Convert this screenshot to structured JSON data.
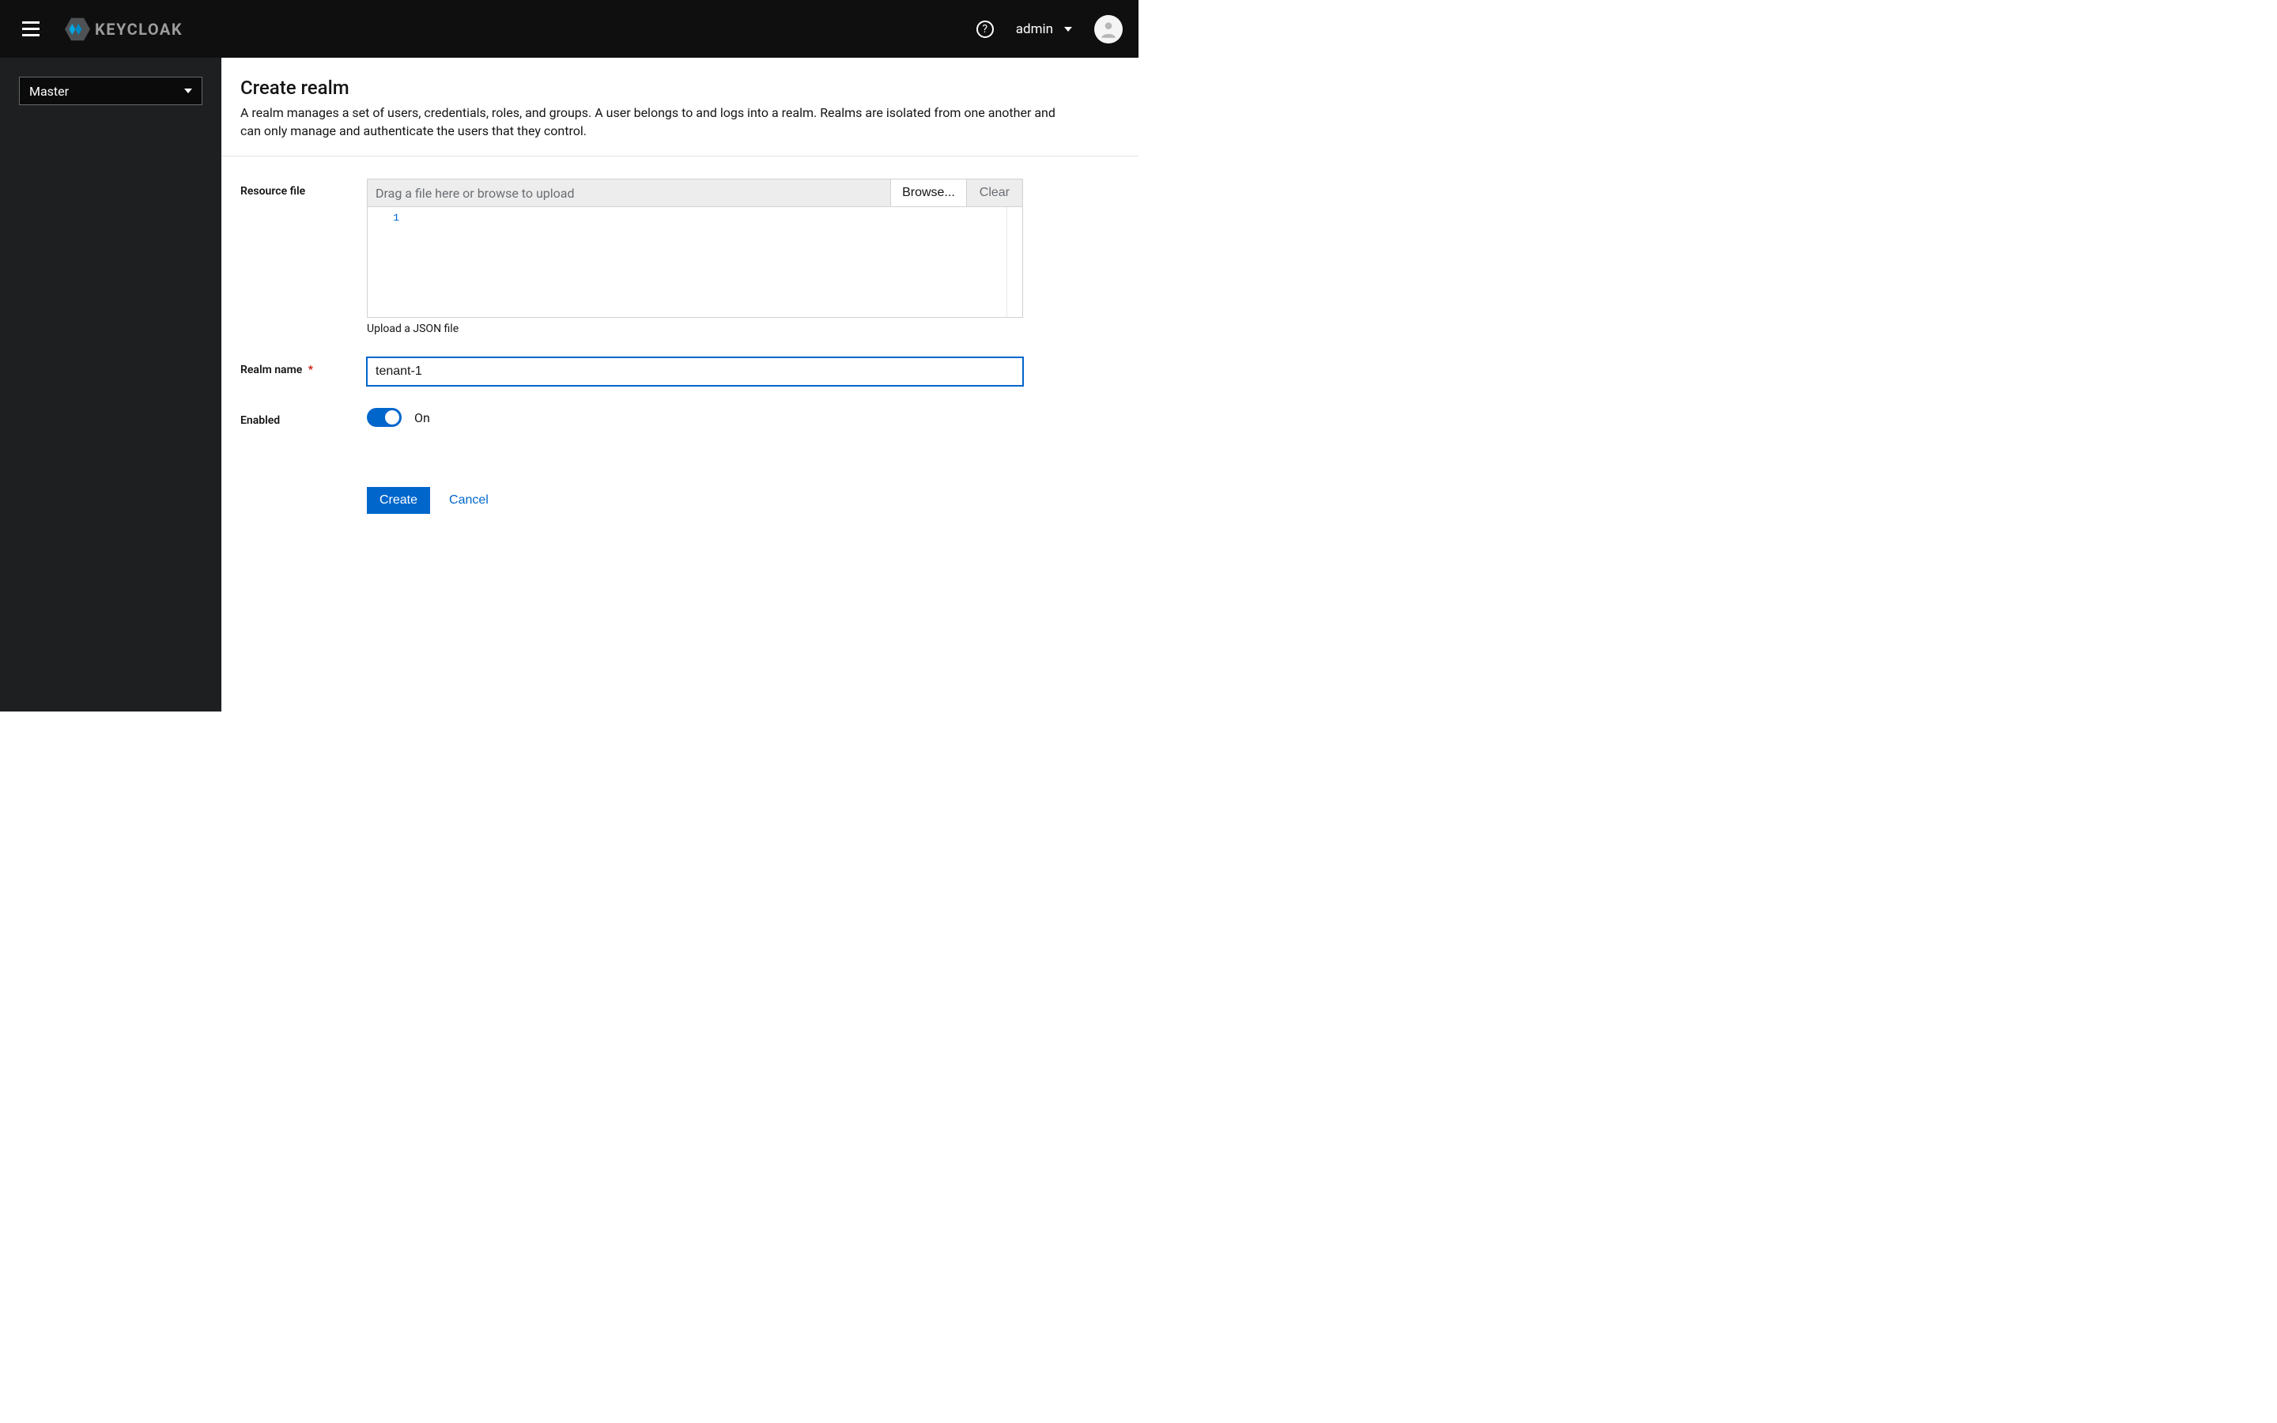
{
  "header": {
    "logo_text": "KEYCLOAK",
    "help_tooltip": "?",
    "user_label": "admin"
  },
  "sidebar": {
    "realm_selected": "Master"
  },
  "page": {
    "title": "Create realm",
    "description": "A realm manages a set of users, credentials, roles, and groups. A user belongs to and logs into a realm. Realms are isolated from one another and can only manage and authenticate the users that they control."
  },
  "form": {
    "resource_file": {
      "label": "Resource file",
      "placeholder": "Drag a file here or browse to upload",
      "browse_label": "Browse...",
      "clear_label": "Clear",
      "gutter_line": "1",
      "helper": "Upload a JSON file"
    },
    "realm_name": {
      "label": "Realm name",
      "required_marker": "*",
      "value": "tenant-1"
    },
    "enabled": {
      "label": "Enabled",
      "state_label": "On"
    },
    "actions": {
      "create": "Create",
      "cancel": "Cancel"
    }
  }
}
